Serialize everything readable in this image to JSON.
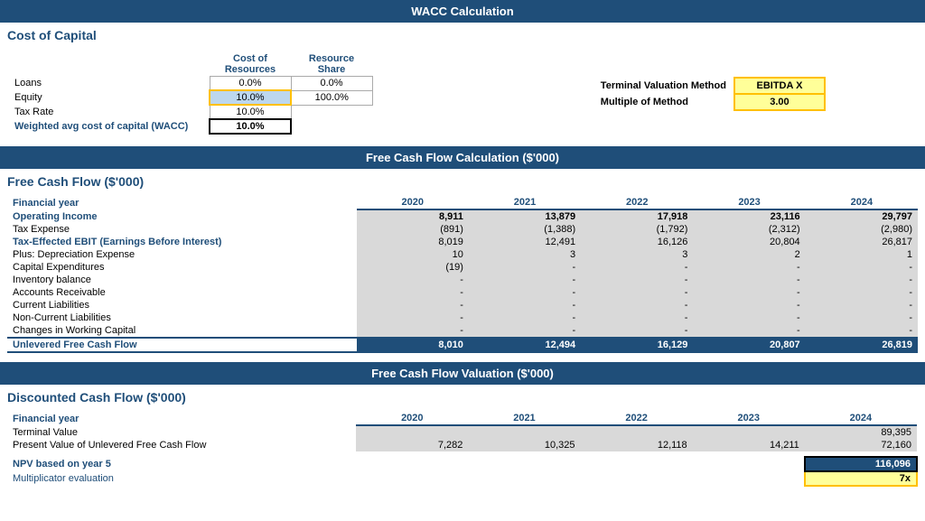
{
  "title": "WACC Calculation",
  "wacc": {
    "section_label": "Cost of Capital",
    "col1_header": "Cost of Resources",
    "col2_header": "Resource Share",
    "rows": [
      {
        "label": "Loans",
        "cost": "0.0%",
        "share": "0.0%",
        "label_bold": false
      },
      {
        "label": "Equity",
        "cost": "10.0%",
        "share": "100.0%",
        "label_bold": false
      },
      {
        "label": "Tax Rate",
        "cost": "10.0%",
        "share": "",
        "label_bold": false
      },
      {
        "label": "Weighted avg cost of capital (WACC)",
        "cost": "10.0%",
        "share": "",
        "label_bold": true
      }
    ],
    "terminal_label": "Terminal Valuation Method",
    "terminal_value": "EBITDA X",
    "multiple_label": "Multiple of Method",
    "multiple_value": "3.00"
  },
  "fcf": {
    "section_header": "Free Cash Flow Calculation ($'000)",
    "section_label": "Free Cash Flow ($'000)",
    "year_label": "Financial year",
    "years": [
      "2020",
      "2021",
      "2022",
      "2023",
      "2024"
    ],
    "rows": [
      {
        "label": "Operating Income",
        "indent": 1,
        "bold": true,
        "values": [
          "8,911",
          "13,879",
          "17,918",
          "23,116",
          "29,797"
        ],
        "bg": "gray"
      },
      {
        "label": "Tax Expense",
        "indent": 2,
        "bold": false,
        "values": [
          "(891)",
          "(1,388)",
          "(1,792)",
          "(2,312)",
          "(2,980)"
        ],
        "bg": "gray"
      },
      {
        "label": "Tax-Effected EBIT (Earnings Before Interest)",
        "indent": 1,
        "bold": true,
        "values": [
          "8,019",
          "12,491",
          "16,126",
          "20,804",
          "26,817"
        ],
        "bg": "gray"
      },
      {
        "label": "Plus: Depreciation Expense",
        "indent": 2,
        "bold": false,
        "values": [
          "10",
          "3",
          "3",
          "2",
          "1"
        ],
        "bg": "gray"
      },
      {
        "label": "Capital Expenditures",
        "indent": 2,
        "bold": false,
        "values": [
          "(19)",
          "-",
          "-",
          "-",
          "-"
        ],
        "bg": "gray"
      },
      {
        "label": "Inventory balance",
        "indent": 3,
        "bold": false,
        "values": [
          "-",
          "-",
          "-",
          "-",
          "-"
        ],
        "bg": "gray"
      },
      {
        "label": "Accounts Receivable",
        "indent": 3,
        "bold": false,
        "values": [
          "-",
          "-",
          "-",
          "-",
          "-"
        ],
        "bg": "gray"
      },
      {
        "label": "Current Liabilities",
        "indent": 3,
        "bold": false,
        "values": [
          "-",
          "-",
          "-",
          "-",
          "-"
        ],
        "bg": "gray"
      },
      {
        "label": "Non-Current Liabilities",
        "indent": 3,
        "bold": false,
        "values": [
          "-",
          "-",
          "-",
          "-",
          "-"
        ],
        "bg": "gray"
      },
      {
        "label": "Changes in Working Capital",
        "indent": 2,
        "bold": false,
        "values": [
          "-",
          "-",
          "-",
          "-",
          "-"
        ],
        "bg": "gray"
      },
      {
        "label": "Unlevered Free Cash Flow",
        "indent": 1,
        "bold": true,
        "values": [
          "8,010",
          "12,494",
          "16,129",
          "20,807",
          "26,819"
        ],
        "bg": "dark",
        "ufcf": true
      }
    ]
  },
  "dcf": {
    "section_header": "Free Cash Flow Valuation ($'000)",
    "section_label": "Discounted Cash Flow ($'000)",
    "year_label": "Financial year",
    "years": [
      "2020",
      "2021",
      "2022",
      "2023",
      "2024"
    ],
    "rows": [
      {
        "label": "Terminal Value",
        "indent": 1,
        "bold": false,
        "values": [
          "",
          "",
          "",
          "",
          "89,395"
        ]
      },
      {
        "label": "Present Value of Unlevered Free Cash Flow",
        "indent": 1,
        "bold": false,
        "values": [
          "7,282",
          "10,325",
          "12,118",
          "14,211",
          "72,160"
        ]
      }
    ],
    "npv_label": "NPV based on year 5",
    "npv_value": "116,096",
    "mult_label": "Multiplicator evaluation",
    "mult_value": "7x"
  }
}
